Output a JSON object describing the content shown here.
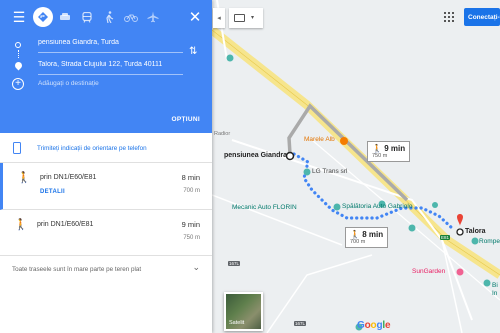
{
  "directions": {
    "modes": [
      "menu-icon",
      "drive-icon",
      "car-icon",
      "transit-icon",
      "walk-icon",
      "bicycle-icon",
      "flight-icon",
      "close-icon"
    ],
    "origin": "pensiunea Giandra, Turda",
    "destination": "Talora, Strada Clujului 122, Turda 40111",
    "add_destination": "Adăugați o destinație",
    "options_label": "OPȚIUNI",
    "send_to_phone": "Trimiteți indicații de orientare pe telefon",
    "routes": [
      {
        "via": "prin DN1/E60/E81",
        "duration": "8 min",
        "distance": "700 m",
        "details": "DETALII"
      },
      {
        "via": "prin DN1/E60/E81",
        "duration": "9 min",
        "distance": "750 m"
      }
    ],
    "flat_note": "Toate traseele sunt în mare parte pe teren plat"
  },
  "map": {
    "labels": {
      "marele_alb": "Marele Alb",
      "lg_trans": "LG Trans srl",
      "spalatoria": "Spălătoria Auto Gabriolo",
      "mecanic": "Mecanic Auto FLORIN",
      "sungarden": "SunGarden",
      "rompet": "Rompe",
      "bi": "Bi",
      "in": "In",
      "origin_label": "pensiunea Giandra",
      "dest_label": "Talora",
      "radior": "Radior"
    },
    "tooltips": [
      {
        "duration": "9 min",
        "distance": "750 m"
      },
      {
        "duration": "8 min",
        "distance": "700 m"
      }
    ],
    "road_badges": [
      "167L",
      "167L",
      "E81"
    ],
    "satellite_label": "Satelit",
    "google": "Google",
    "connect_label": "Conectați-vă"
  },
  "colors": {
    "accent": "#4285f4",
    "route": "#4285f4",
    "alt_route": "#aaaaaa",
    "highway": "#f6e58d",
    "dest_pin": "#ea4335",
    "poi_teal": "#4db6ac"
  }
}
